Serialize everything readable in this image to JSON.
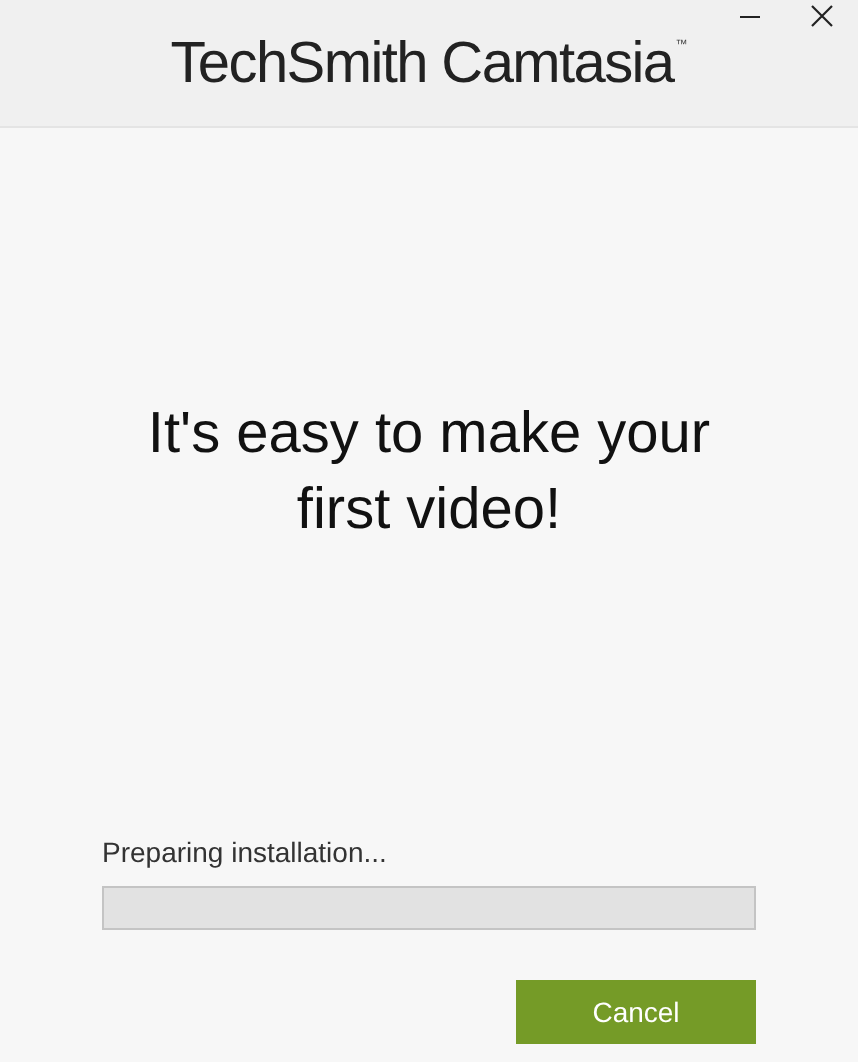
{
  "window": {
    "title": "TechSmith Camtasia",
    "trademark": "™"
  },
  "headline": "It's easy to make your first video!",
  "progress": {
    "label": "Preparing installation...",
    "level": 0
  },
  "buttons": [
    "Cancel"
  ]
}
